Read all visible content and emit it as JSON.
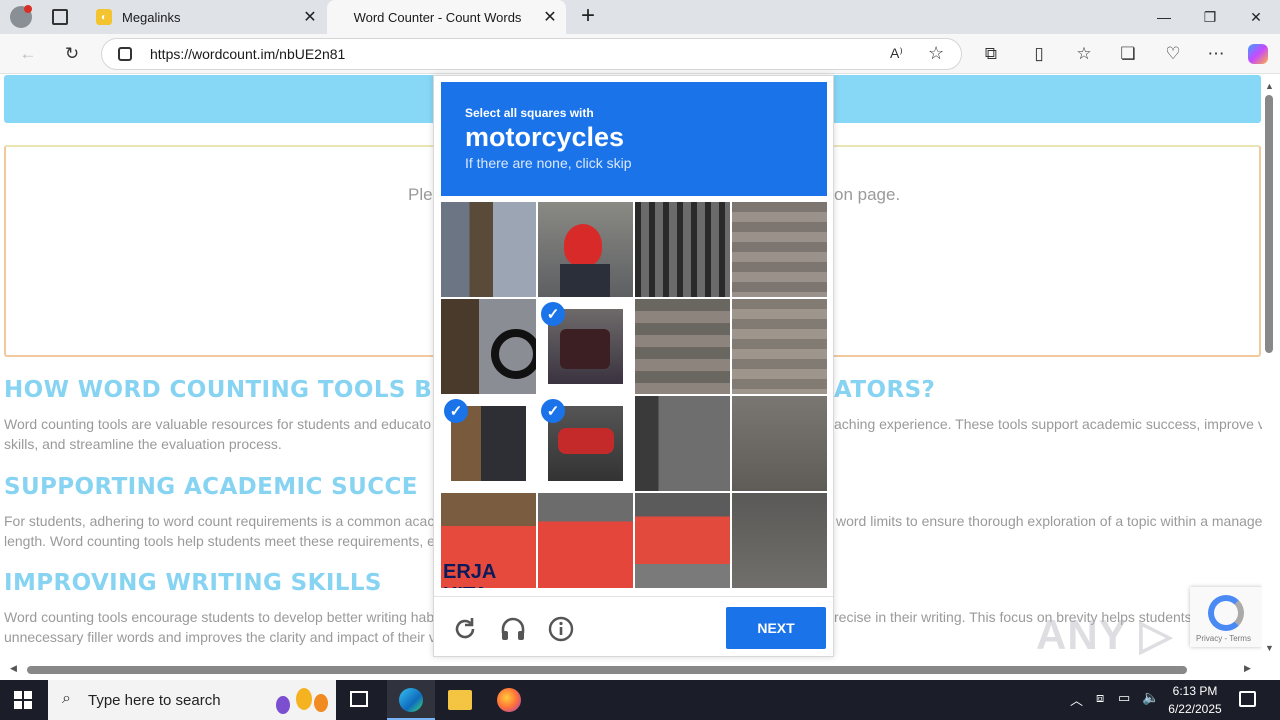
{
  "browser": {
    "tabs": [
      {
        "title": "Megalinks",
        "active": false
      },
      {
        "title": "Word Counter - Count Words",
        "active": true
      }
    ],
    "url": "https://wordcount.im/nbUE2n81",
    "new_tab_glyph": "+",
    "close_glyph": "✕"
  },
  "page": {
    "notice_left": "Ple",
    "notice_right": "on page.",
    "sections": [
      {
        "heading_left": "HOW WORD COUNTING TOOLS B",
        "heading_right": "ATORS?",
        "line1_left": "Word counting tools are valuable resources for students and educato",
        "line1_right": "aching experience. These tools support academic success, improve v",
        "line2_left": "skills, and streamline the evaluation process."
      },
      {
        "heading_left": "SUPPORTING ACADEMIC SUCCE",
        "line1_left": "For students, adhering to word count requirements is a common acac",
        "line1_right": "word limits to ensure thorough exploration of a topic within a manage",
        "line2_left": "length. Word counting tools help students meet these requirements, e"
      },
      {
        "heading_left": "IMPROVING WRITING SKILLS",
        "line1_left": "Word counting tools encourage students to develop better writing hab",
        "line1_right": "recise in their writing. This focus on brevity helps students",
        "line2_left": "unnecessary filler words and improves the clarity and impact of their v"
      }
    ]
  },
  "captcha": {
    "instruction": "Select all squares with",
    "target": "motorcycles",
    "hint": "If there are none, click skip",
    "next_label": "NEXT",
    "selected_tiles": [
      5,
      8,
      9
    ],
    "banner_text": "ERJA KITA"
  },
  "recaptcha_badge": {
    "links": "Privacy - Terms"
  },
  "watermark": "ANY.RUN",
  "taskbar": {
    "search_placeholder": "Type here to search",
    "time": "6:13 PM",
    "date": "6/22/2025"
  },
  "colors": {
    "accent": "#1a73e8",
    "heading": "#87d3f2",
    "banner": "#87d8f7"
  }
}
